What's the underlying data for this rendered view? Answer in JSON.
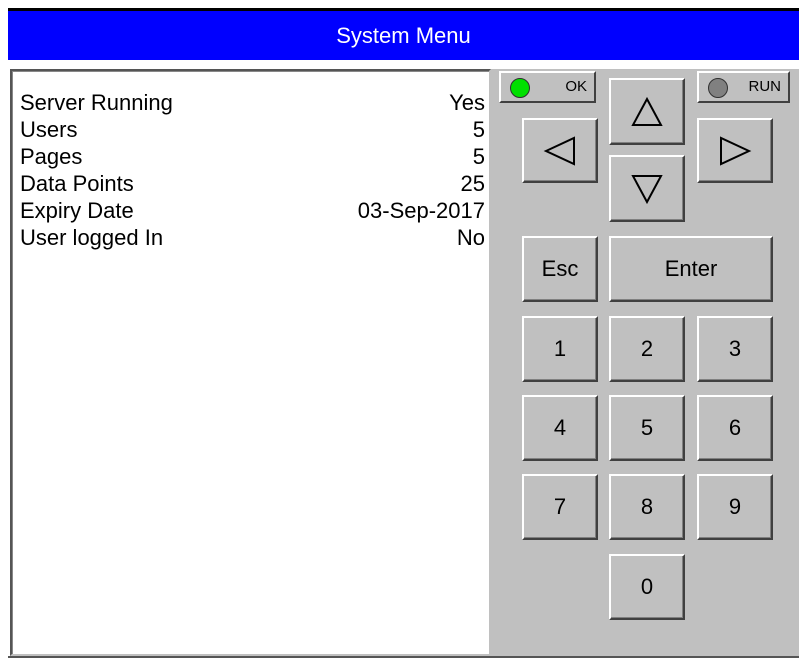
{
  "window": {
    "title": "System Menu"
  },
  "info": {
    "rows": [
      {
        "label": "Server Running",
        "value": "Yes"
      },
      {
        "label": "Users",
        "value": "5"
      },
      {
        "label": "Pages",
        "value": "5"
      },
      {
        "label": "Data Points",
        "value": "25"
      },
      {
        "label": "Expiry Date",
        "value": "03-Sep-2017"
      },
      {
        "label": "User logged In",
        "value": "No"
      }
    ]
  },
  "indicators": {
    "ok": {
      "label": "OK",
      "color": "#00e000"
    },
    "run": {
      "label": "RUN",
      "color": "#808080"
    }
  },
  "keypad": {
    "esc_label": "Esc",
    "enter_label": "Enter",
    "digits": [
      "1",
      "2",
      "3",
      "4",
      "5",
      "6",
      "7",
      "8",
      "9",
      "0"
    ],
    "arrows": {
      "up": "up-arrow-icon",
      "down": "down-arrow-icon",
      "left": "left-arrow-icon",
      "right": "right-arrow-icon"
    }
  },
  "colors": {
    "title_bar": "#0000ff",
    "panel": "#c0c0c0"
  }
}
